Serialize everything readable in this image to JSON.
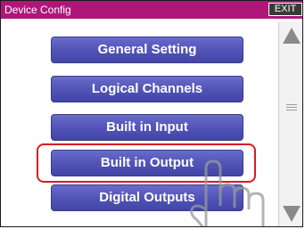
{
  "window": {
    "title": "Device Config",
    "exit_label": "EXIT"
  },
  "menu": [
    {
      "label": "General Setting"
    },
    {
      "label": "Logical Channels"
    },
    {
      "label": "Built in Input"
    },
    {
      "label": "Built in Output"
    },
    {
      "label": "Digital Outputs"
    }
  ],
  "highlighted_item": "Built in Output",
  "colors": {
    "titlebar": "#b0167a",
    "button": "#5254b8",
    "highlight": "#d91a22"
  },
  "icons": {
    "scroll_up": "triangle-up-icon",
    "scroll_down": "triangle-down-icon",
    "grip": "grip-lines-icon",
    "pointer": "tap-hand-icon"
  }
}
